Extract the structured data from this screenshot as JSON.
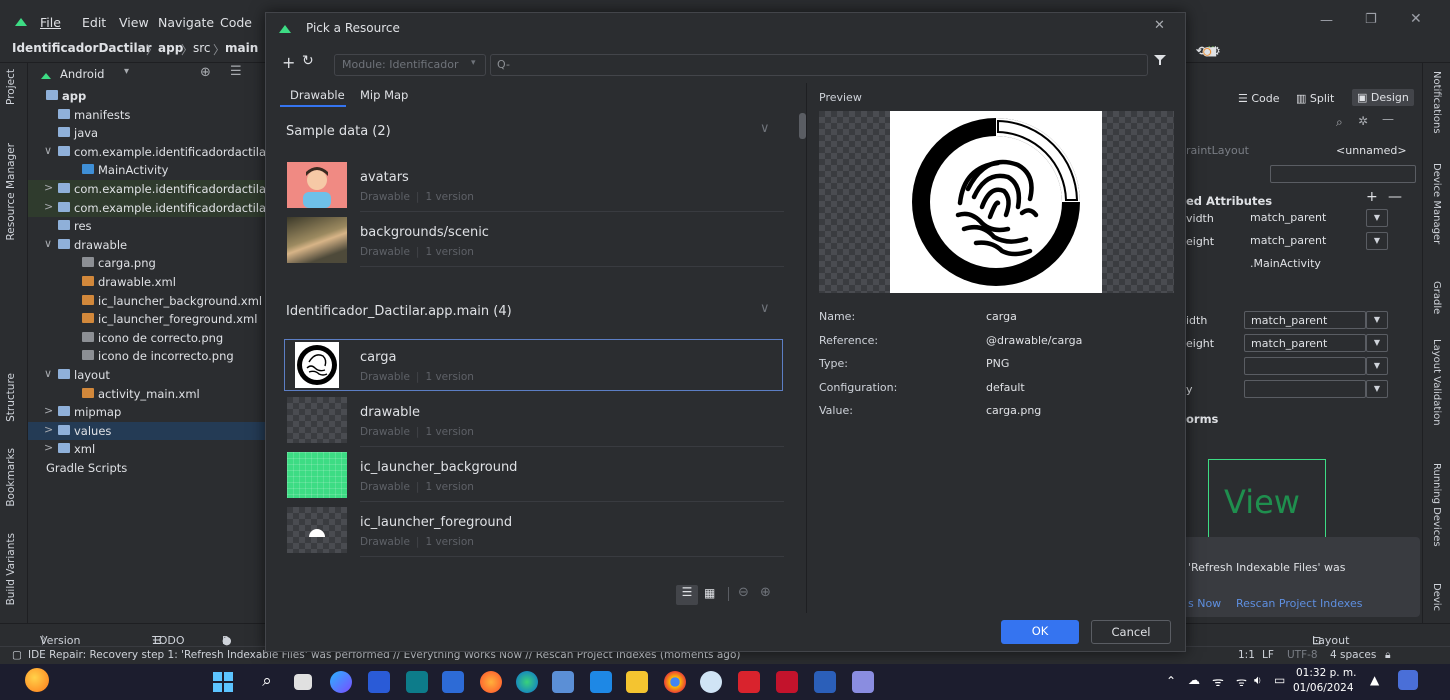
{
  "menubar": {
    "items": [
      "File",
      "Edit",
      "View",
      "Navigate",
      "Code"
    ]
  },
  "breadcrumb": {
    "project": "IdentificadorDactilar",
    "module": "app",
    "src": "src",
    "main": "main"
  },
  "left_stripe": {
    "tabs": [
      "Project",
      "Resource Manager",
      "Structure",
      "Bookmarks",
      "Build Variants"
    ]
  },
  "project_panel": {
    "view_selector": "Android",
    "tree": [
      {
        "label": "app",
        "icon": "folder",
        "arrow": "",
        "indent": 0,
        "bold": true
      },
      {
        "label": "manifests",
        "icon": "folder",
        "arrow": "",
        "indent": 1
      },
      {
        "label": "java",
        "icon": "folder",
        "arrow": "",
        "indent": 1
      },
      {
        "label": "com.example.identificadordactilar",
        "icon": "folder",
        "arrow": "∨",
        "indent": 1
      },
      {
        "label": "MainActivity",
        "icon": "kt",
        "arrow": "",
        "indent": 3
      },
      {
        "label": "com.example.identificadordactilar",
        "icon": "folder",
        "arrow": ">",
        "indent": 1,
        "highlight": "green"
      },
      {
        "label": "com.example.identificadordactilar",
        "icon": "folder",
        "arrow": ">",
        "indent": 1,
        "highlight": "green"
      },
      {
        "label": "res",
        "icon": "folder",
        "arrow": "",
        "indent": 1
      },
      {
        "label": "drawable",
        "icon": "folder",
        "arrow": "∨",
        "indent": 1
      },
      {
        "label": "carga.png",
        "icon": "img",
        "arrow": "",
        "indent": 3
      },
      {
        "label": "drawable.xml",
        "icon": "xml",
        "arrow": "",
        "indent": 3
      },
      {
        "label": "ic_launcher_background.xml",
        "icon": "xml",
        "arrow": "",
        "indent": 3
      },
      {
        "label": "ic_launcher_foreground.xml",
        "icon": "xml",
        "arrow": "",
        "indent": 3
      },
      {
        "label": "icono de correcto.png",
        "icon": "img",
        "arrow": "",
        "indent": 3
      },
      {
        "label": "icono de incorrecto.png",
        "icon": "img",
        "arrow": "",
        "indent": 3
      },
      {
        "label": "layout",
        "icon": "folder",
        "arrow": "∨",
        "indent": 1
      },
      {
        "label": "activity_main.xml",
        "icon": "xml",
        "arrow": "",
        "indent": 3
      },
      {
        "label": "mipmap",
        "icon": "folder",
        "arrow": ">",
        "indent": 1
      },
      {
        "label": "values",
        "icon": "folder",
        "arrow": ">",
        "indent": 1,
        "highlight": "blue"
      },
      {
        "label": "xml",
        "icon": "folder",
        "arrow": ">",
        "indent": 1
      },
      {
        "label": "Gradle Scripts",
        "icon": "none",
        "arrow": "",
        "indent": 0
      }
    ]
  },
  "dialog": {
    "title": "Pick a Resource",
    "module_combo": "Module: Identificador",
    "search_placeholder": "Q-",
    "tabs": [
      "Drawable",
      "Mip Map"
    ],
    "groups": [
      {
        "title": "Sample data (2)",
        "items": [
          {
            "name": "avatars",
            "type": "Drawable",
            "version": "1 version",
            "thumb": "avatar"
          },
          {
            "name": "backgrounds/scenic",
            "type": "Drawable",
            "version": "1 version",
            "thumb": "scenic"
          }
        ]
      },
      {
        "title": "Identificador_Dactilar.app.main (4)",
        "items": [
          {
            "name": "carga",
            "type": "Drawable",
            "version": "1 version",
            "thumb": "fingerprint",
            "selected": true
          },
          {
            "name": "drawable",
            "type": "Drawable",
            "version": "1 version",
            "thumb": "checker"
          },
          {
            "name": "ic_launcher_background",
            "type": "Drawable",
            "version": "1 version",
            "thumb": "green"
          },
          {
            "name": "ic_launcher_foreground",
            "type": "Drawable",
            "version": "1 version",
            "thumb": "android"
          }
        ]
      }
    ],
    "preview": {
      "label": "Preview",
      "props": [
        {
          "k": "Name:",
          "v": "carga"
        },
        {
          "k": "Reference:",
          "v": "@drawable/carga"
        },
        {
          "k": "Type:",
          "v": "PNG"
        },
        {
          "k": "Configuration:",
          "v": "default"
        },
        {
          "k": "Value:",
          "v": "carga.png"
        }
      ]
    },
    "ok_label": "OK",
    "cancel_label": "Cancel"
  },
  "right_panel": {
    "mode_code": "Code",
    "mode_split": "Split",
    "mode_design": "Design",
    "layout_name": "raintLayout",
    "layout_id": "<unnamed>",
    "declared_attributes": "ed Attributes",
    "attrs1": [
      {
        "k": "vidth",
        "v": "match_parent"
      },
      {
        "k": "eight",
        "v": "match_parent"
      },
      {
        "k": "",
        "v": ".MainActivity"
      }
    ],
    "attrs2": [
      {
        "k": "idth",
        "v": "match_parent"
      },
      {
        "k": "eight",
        "v": "match_parent"
      },
      {
        "k": "",
        "v": ""
      },
      {
        "k": "y",
        "v": ""
      }
    ],
    "transforms": "orms",
    "view_label": "View",
    "notification_text": "'Refresh Indexable Files' was",
    "notification_action1": "s Now",
    "notification_action2": "Rescan Project Indexes"
  },
  "right_stripe": {
    "tabs": [
      "Notifications",
      "Device Manager",
      "Gradle",
      "Layout Validation",
      "Running Devices",
      "Devic"
    ]
  },
  "bottom_tabs": [
    "Version Control",
    "TODO",
    "P"
  ],
  "layout_inspector": "Layout Inspector",
  "status": {
    "message": "IDE Repair: Recovery step 1: 'Refresh Indexable Files' was performed // Everything Works Now // Rescan Project Indexes (moments ago)",
    "pos": "1:1",
    "line_sep": "LF",
    "encoding": "UTF-8",
    "indent": "4 spaces"
  },
  "tray": {
    "time": "01:32 p. m.",
    "date": "01/06/2024"
  },
  "colors": {
    "accent": "#3574f0",
    "ide_bg": "#2b2d30",
    "taskbar": "#1c1d2e"
  }
}
